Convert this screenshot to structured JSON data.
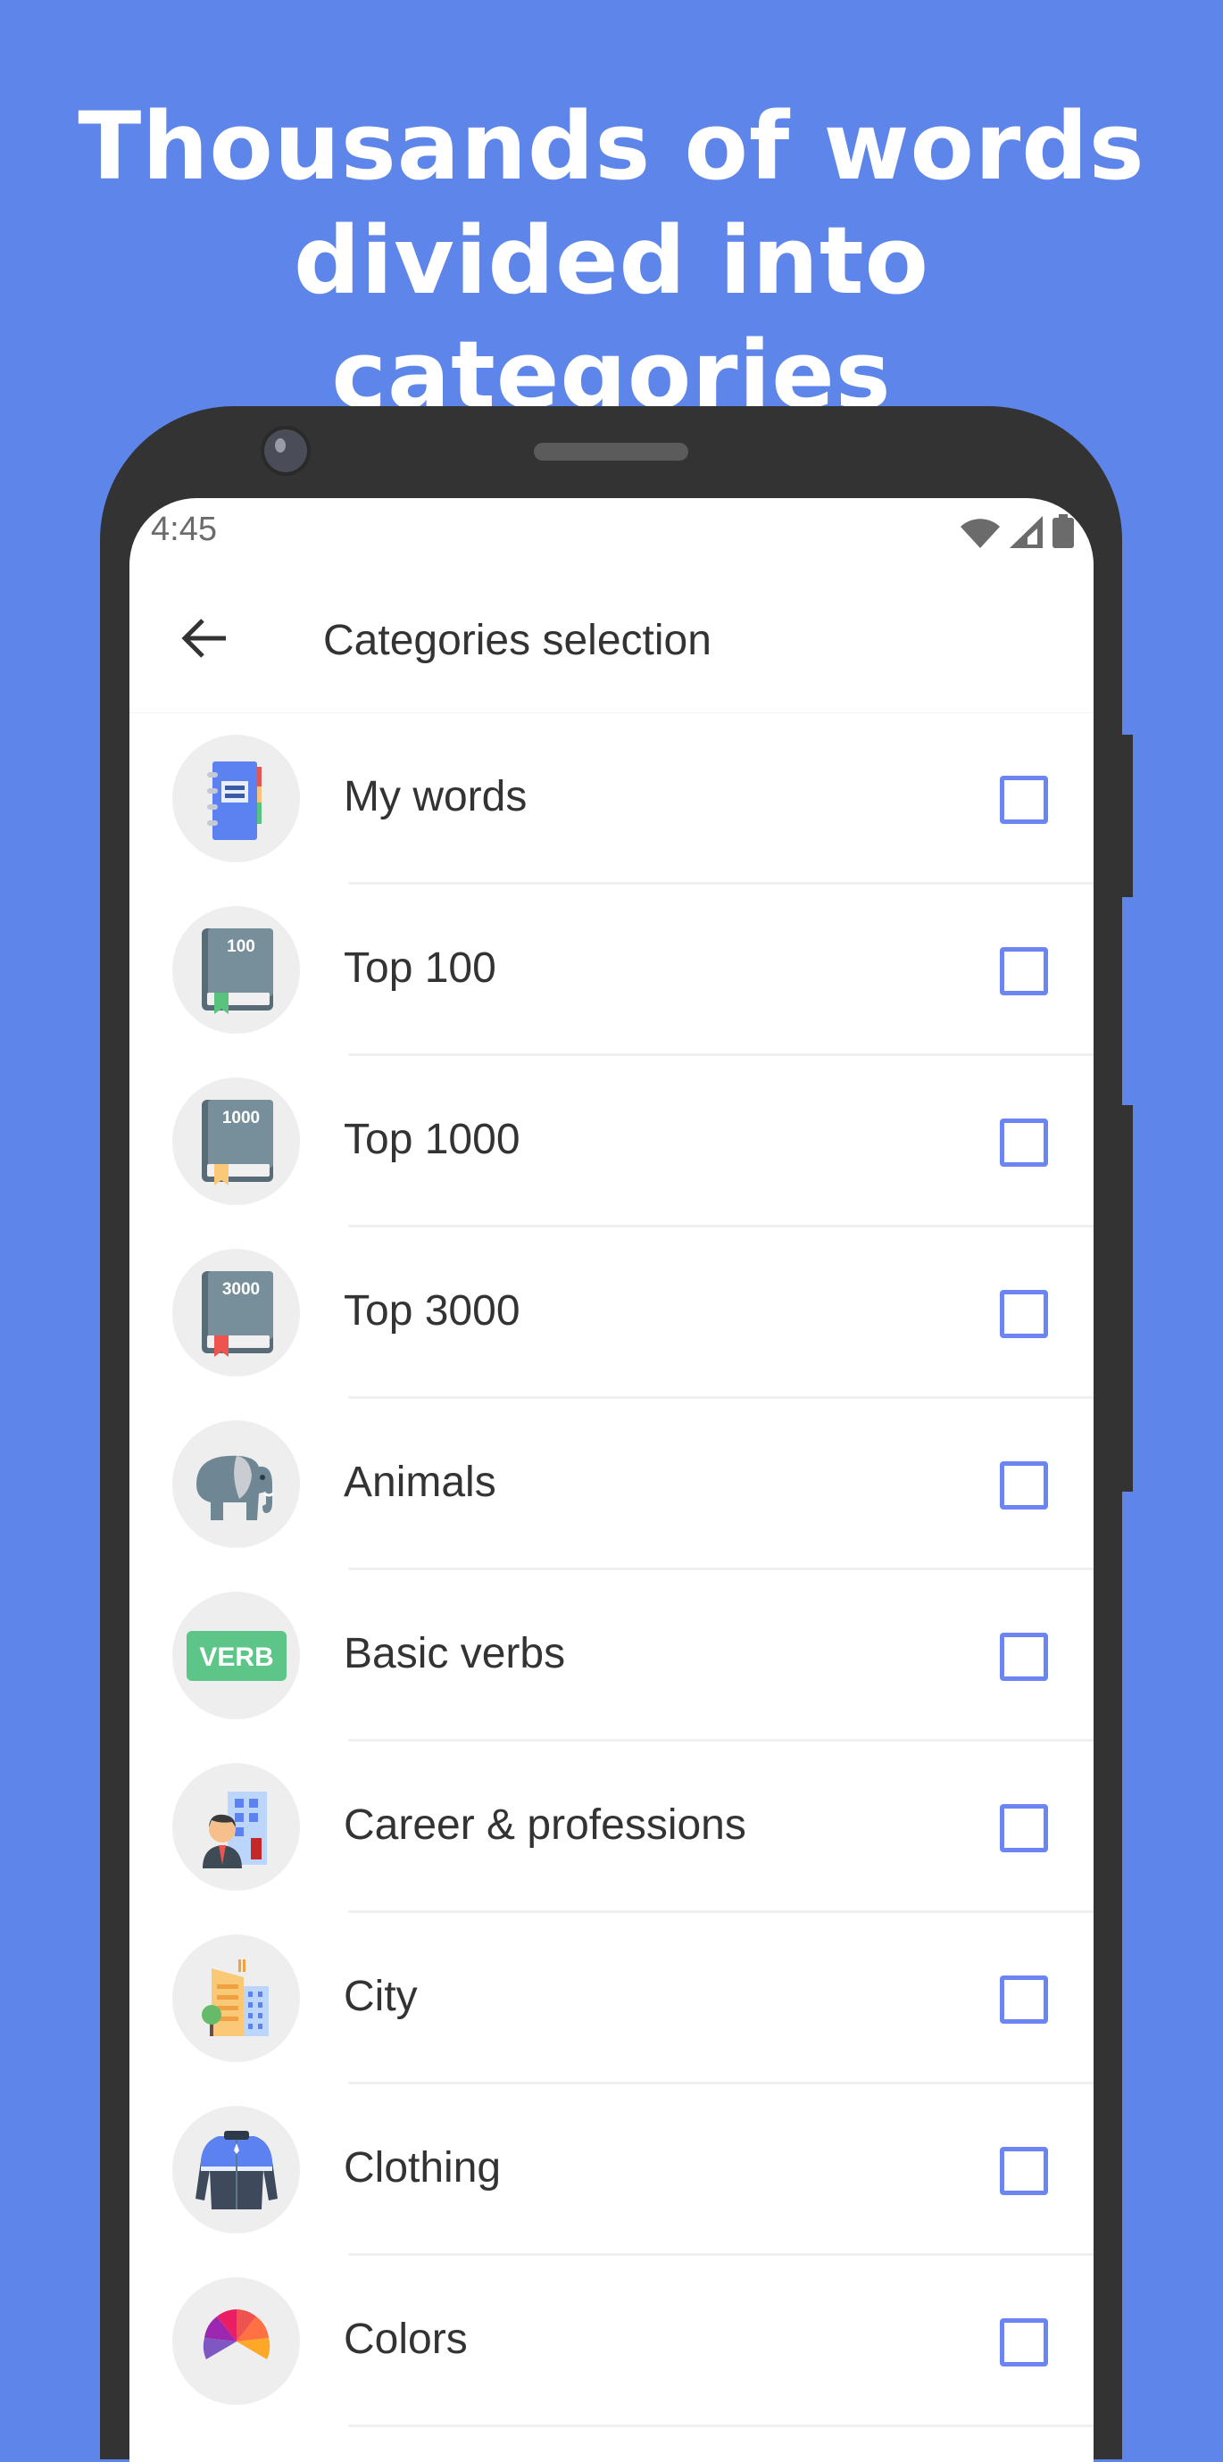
{
  "headline": {
    "line1": "Thousands of words",
    "line2": "divided into categories"
  },
  "colors": {
    "background": "#5e86ea",
    "phone_body": "#333333",
    "accent_checkbox": "#6b86f2",
    "text_primary": "#333333",
    "icon_circle": "#eeeeee"
  },
  "status_bar": {
    "time": "4:45",
    "icons": [
      "wifi-icon",
      "cell-signal-icon",
      "battery-icon"
    ]
  },
  "app_bar": {
    "back_icon": "arrow-left-icon",
    "title": "Categories selection"
  },
  "categories": [
    {
      "label": "My words",
      "icon": "notebook-icon",
      "checked": false
    },
    {
      "label": "Top 100",
      "icon": "book-100-icon",
      "badge": "100",
      "checked": false
    },
    {
      "label": "Top 1000",
      "icon": "book-1000-icon",
      "badge": "1000",
      "checked": false
    },
    {
      "label": "Top 3000",
      "icon": "book-3000-icon",
      "badge": "3000",
      "checked": false
    },
    {
      "label": "Animals",
      "icon": "elephant-icon",
      "checked": false
    },
    {
      "label": "Basic verbs",
      "icon": "verb-tag-icon",
      "badge": "VERB",
      "checked": false
    },
    {
      "label": "Career & professions",
      "icon": "businessman-icon",
      "checked": false
    },
    {
      "label": "City",
      "icon": "city-buildings-icon",
      "checked": false
    },
    {
      "label": "Clothing",
      "icon": "jacket-icon",
      "checked": false
    },
    {
      "label": "Colors",
      "icon": "color-wheel-icon",
      "checked": false
    }
  ]
}
